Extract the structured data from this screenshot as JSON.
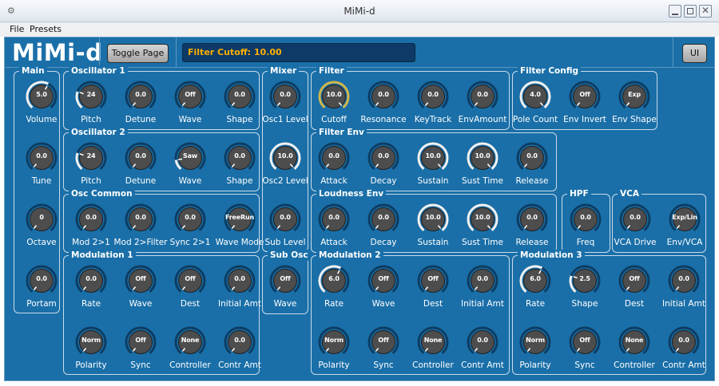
{
  "window": {
    "title": "MiMi-d",
    "icon": "app-icon"
  },
  "menu": [
    {
      "label": "File"
    },
    {
      "label": "Presets"
    }
  ],
  "header": {
    "logo": "MiMi-d",
    "toggle_label": "Toggle Page",
    "status": "Filter Cutoff:  10.00",
    "ui_label": "UI"
  },
  "colors": {
    "background": "#1a6fa8",
    "panel_border": "#c9dbea",
    "status_text": "#ffb000",
    "highlight_knob_ring": "#d1b84c"
  },
  "panels": [
    {
      "id": "main",
      "title": "Main",
      "knobs": [
        {
          "label": "Volume",
          "value": "5.0",
          "level": 0.6
        },
        {
          "label": "Tune",
          "value": "0.0",
          "level": 0.0
        },
        {
          "label": "Octave",
          "value": "0",
          "level": 0.0
        },
        {
          "label": "Portam",
          "value": "0.0",
          "level": 0.0
        }
      ]
    },
    {
      "id": "osc1",
      "title": "Oscillator 1",
      "knobs": [
        {
          "label": "Pitch",
          "value": "24",
          "level": 0.25
        },
        {
          "label": "Detune",
          "value": "0.0",
          "level": 0.0
        },
        {
          "label": "Wave",
          "value": "Off",
          "level": 0.0
        },
        {
          "label": "Shape",
          "value": "0.0",
          "level": 0.0
        }
      ]
    },
    {
      "id": "osc2",
      "title": "Oscillator 2",
      "knobs": [
        {
          "label": "Pitch",
          "value": "24",
          "level": 0.25
        },
        {
          "label": "Detune",
          "value": "0.0",
          "level": 0.0
        },
        {
          "label": "Wave",
          "value": "Saw",
          "level": 0.15
        },
        {
          "label": "Shape",
          "value": "0.0",
          "level": 0.0
        }
      ]
    },
    {
      "id": "osc-common",
      "title": "Osc Common",
      "knobs": [
        {
          "label": "Mod 2>1",
          "value": "0.0",
          "level": 0.0
        },
        {
          "label": "Mod 2>Filter",
          "value": "0.0",
          "level": 0.0
        },
        {
          "label": "Sync 2>1",
          "value": "0.0",
          "level": 0.0
        },
        {
          "label": "Wave Mode",
          "value": "FreeRun",
          "level": 0.0
        }
      ]
    },
    {
      "id": "mod1",
      "title": "Modulation 1",
      "knobs": [
        {
          "label": "Rate",
          "value": "0.0",
          "level": 0.0
        },
        {
          "label": "Wave",
          "value": "Off",
          "level": 0.0
        },
        {
          "label": "Dest",
          "value": "Off",
          "level": 0.0
        },
        {
          "label": "Initial Amt",
          "value": "0.0",
          "level": 0.0
        },
        {
          "label": "Polarity",
          "value": "Norm",
          "level": 0.0
        },
        {
          "label": "Sync",
          "value": "Off",
          "level": 0.0
        },
        {
          "label": "Controller",
          "value": "None",
          "level": 0.0
        },
        {
          "label": "Contr Amt",
          "value": "0.0",
          "level": 0.0
        }
      ]
    },
    {
      "id": "mixer",
      "title": "Mixer",
      "knobs": [
        {
          "label": "Osc1 Level",
          "value": "0.0",
          "level": 0.0
        },
        {
          "label": "Osc2 Level",
          "value": "10.0",
          "level": 1.0
        },
        {
          "label": "Sub Level",
          "value": "0.0",
          "level": 0.0
        }
      ]
    },
    {
      "id": "sub-osc",
      "title": "Sub Osc",
      "knobs": [
        {
          "label": "Wave",
          "value": "Off",
          "level": 0.0
        }
      ]
    },
    {
      "id": "filter",
      "title": "Filter",
      "knobs": [
        {
          "label": "Cutoff",
          "value": "10.0",
          "level": 1.0
        },
        {
          "label": "Resonance",
          "value": "0.0",
          "level": 0.0
        },
        {
          "label": "KeyTrack",
          "value": "0.0",
          "level": 0.0
        },
        {
          "label": "EnvAmount",
          "value": "0.0",
          "level": 0.0
        }
      ]
    },
    {
      "id": "filter-config",
      "title": "Filter Config",
      "knobs": [
        {
          "label": "Pole Count",
          "value": "4.0",
          "level": 1.0
        },
        {
          "label": "Env Invert",
          "value": "Off",
          "level": 0.0
        },
        {
          "label": "Env Shape",
          "value": "Exp",
          "level": 0.0
        }
      ]
    },
    {
      "id": "filter-env",
      "title": "Filter Env",
      "knobs": [
        {
          "label": "Attack",
          "value": "0.0",
          "level": 0.0
        },
        {
          "label": "Decay",
          "value": "0.0",
          "level": 0.0
        },
        {
          "label": "Sustain",
          "value": "10.0",
          "level": 1.0
        },
        {
          "label": "Sust Time",
          "value": "10.0",
          "level": 1.0
        },
        {
          "label": "Release",
          "value": "0.0",
          "level": 0.0
        }
      ]
    },
    {
      "id": "loudness-env",
      "title": "Loudness Env",
      "knobs": [
        {
          "label": "Attack",
          "value": "0.0",
          "level": 0.0
        },
        {
          "label": "Decay",
          "value": "0.0",
          "level": 0.0
        },
        {
          "label": "Sustain",
          "value": "10.0",
          "level": 1.0
        },
        {
          "label": "Sust Time",
          "value": "10.0",
          "level": 1.0
        },
        {
          "label": "Release",
          "value": "0.0",
          "level": 0.0
        }
      ]
    },
    {
      "id": "hpf",
      "title": "HPF",
      "knobs": [
        {
          "label": "Freq",
          "value": "0.0",
          "level": 0.0
        }
      ]
    },
    {
      "id": "vca",
      "title": "VCA",
      "knobs": [
        {
          "label": "VCA Drive",
          "value": "0.0",
          "level": 0.0
        },
        {
          "label": "Env/VCA",
          "value": "Exp/Lin",
          "level": 0.0
        }
      ]
    },
    {
      "id": "mod2",
      "title": "Modulation 2",
      "knobs": [
        {
          "label": "Rate",
          "value": "6.0",
          "level": 0.6
        },
        {
          "label": "Wave",
          "value": "Off",
          "level": 0.0
        },
        {
          "label": "Dest",
          "value": "Off",
          "level": 0.0
        },
        {
          "label": "Initial Amt",
          "value": "0.0",
          "level": 0.0
        },
        {
          "label": "Polarity",
          "value": "Norm",
          "level": 0.0
        },
        {
          "label": "Sync",
          "value": "Off",
          "level": 0.0
        },
        {
          "label": "Controller",
          "value": "None",
          "level": 0.0
        },
        {
          "label": "Contr Amt",
          "value": "0.0",
          "level": 0.0
        }
      ]
    },
    {
      "id": "mod3",
      "title": "Modulation 3",
      "knobs": [
        {
          "label": "Rate",
          "value": "6.0",
          "level": 0.6
        },
        {
          "label": "Shape",
          "value": "2.5",
          "level": 0.25
        },
        {
          "label": "Dest",
          "value": "Off",
          "level": 0.0
        },
        {
          "label": "Initial Amt",
          "value": "0.0",
          "level": 0.0
        },
        {
          "label": "Polarity",
          "value": "Norm",
          "level": 0.0
        },
        {
          "label": "Sync",
          "value": "Off",
          "level": 0.0
        },
        {
          "label": "Controller",
          "value": "None",
          "level": 0.0
        },
        {
          "label": "Contr Amt",
          "value": "0.0",
          "level": 0.0
        }
      ]
    }
  ]
}
